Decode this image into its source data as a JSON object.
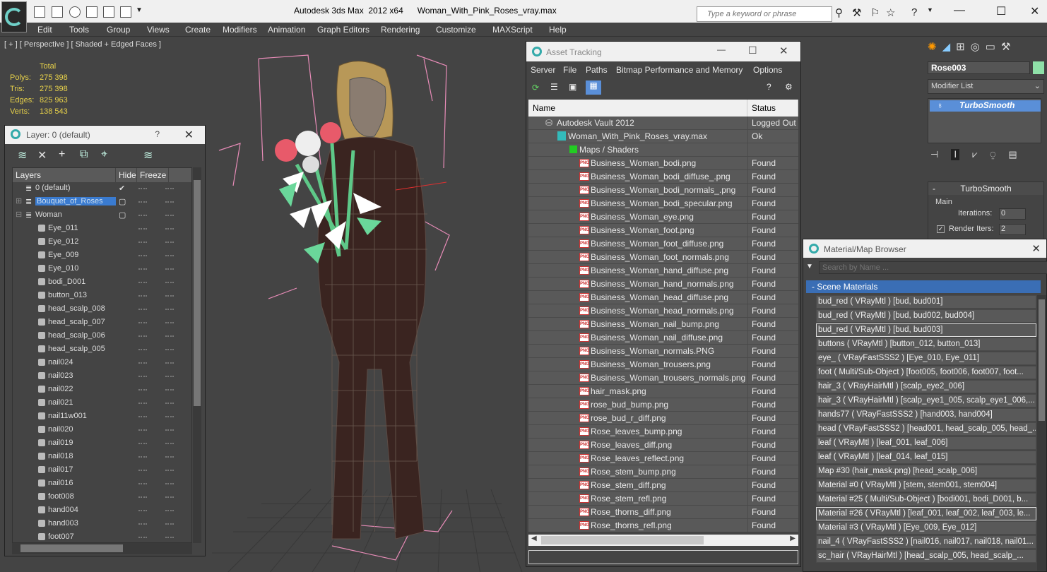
{
  "app": {
    "title": "Autodesk 3ds Max  2012 x64      Woman_With_Pink_Roses_vray.max",
    "search_placeholder": "Type a keyword or phrase"
  },
  "menu": [
    "Edit",
    "Tools",
    "Group",
    "Views",
    "Create",
    "Modifiers",
    "Animation",
    "Graph Editors",
    "Rendering",
    "Customize",
    "MAXScript",
    "Help"
  ],
  "viewport": {
    "label": "[ + ] [ Perspective ] [ Shaded + Edged Faces ]",
    "stats_header": "Total",
    "stats": [
      {
        "key": "Polys:",
        "value": "275 398"
      },
      {
        "key": "Tris:",
        "value": "275 398"
      },
      {
        "key": "Edges:",
        "value": "825 963"
      },
      {
        "key": "Verts:",
        "value": "138 543"
      }
    ]
  },
  "layer_dialog": {
    "title": "Layer: 0 (default)",
    "help": "?",
    "columns": [
      "Layers",
      "Hide",
      "Freeze"
    ],
    "layers": [
      {
        "name": "0 (default)",
        "level": 0,
        "check": "✔",
        "selected": false
      },
      {
        "name": "Bouquet_of_Roses",
        "level": 0,
        "check": "▢",
        "selected": true
      },
      {
        "name": "Woman",
        "level": 0,
        "check": "▢",
        "selected": false
      }
    ],
    "objects": [
      "Eye_011",
      "Eye_012",
      "Eye_009",
      "Eye_010",
      "bodi_D001",
      "button_013",
      "head_scalp_008",
      "head_scalp_007",
      "head_scalp_006",
      "head_scalp_005",
      "nail024",
      "nail023",
      "nail022",
      "nail021",
      "nail11w001",
      "nail020",
      "nail019",
      "nail018",
      "nail017",
      "nail016",
      "foot008",
      "hand004",
      "hand003",
      "foot007"
    ]
  },
  "asset_tracking": {
    "title": "Asset Tracking",
    "menu": [
      "Server",
      "File",
      "Paths",
      "Bitmap Performance and Memory",
      "Options"
    ],
    "columns": [
      "Name",
      "Status"
    ],
    "rows": [
      {
        "name": "Autodesk Vault 2012",
        "status": "Logged Out",
        "icon": "vault",
        "indent": 0
      },
      {
        "name": "Woman_With_Pink_Roses_vray.max",
        "status": "Ok",
        "icon": "max",
        "indent": 1
      },
      {
        "name": "Maps / Shaders",
        "status": "",
        "icon": "maps",
        "indent": 2
      },
      {
        "name": "Business_Woman_bodi.png",
        "status": "Found",
        "icon": "png",
        "indent": 3
      },
      {
        "name": "Business_Woman_bodi_diffuse_.png",
        "status": "Found",
        "icon": "png",
        "indent": 3
      },
      {
        "name": "Business_Woman_bodi_normals_.png",
        "status": "Found",
        "icon": "png",
        "indent": 3
      },
      {
        "name": "Business_Woman_bodi_specular.png",
        "status": "Found",
        "icon": "png",
        "indent": 3
      },
      {
        "name": "Business_Woman_eye.png",
        "status": "Found",
        "icon": "png",
        "indent": 3
      },
      {
        "name": "Business_Woman_foot.png",
        "status": "Found",
        "icon": "png",
        "indent": 3
      },
      {
        "name": "Business_Woman_foot_diffuse.png",
        "status": "Found",
        "icon": "png",
        "indent": 3
      },
      {
        "name": "Business_Woman_foot_normals.png",
        "status": "Found",
        "icon": "png",
        "indent": 3
      },
      {
        "name": "Business_Woman_hand_diffuse.png",
        "status": "Found",
        "icon": "png",
        "indent": 3
      },
      {
        "name": "Business_Woman_hand_normals.png",
        "status": "Found",
        "icon": "png",
        "indent": 3
      },
      {
        "name": "Business_Woman_head_diffuse.png",
        "status": "Found",
        "icon": "png",
        "indent": 3
      },
      {
        "name": "Business_Woman_head_normals.png",
        "status": "Found",
        "icon": "png",
        "indent": 3
      },
      {
        "name": "Business_Woman_nail_bump.png",
        "status": "Found",
        "icon": "png",
        "indent": 3
      },
      {
        "name": "Business_Woman_nail_diffuse.png",
        "status": "Found",
        "icon": "png",
        "indent": 3
      },
      {
        "name": "Business_Woman_normals.PNG",
        "status": "Found",
        "icon": "png",
        "indent": 3
      },
      {
        "name": "Business_Woman_trousers.png",
        "status": "Found",
        "icon": "png",
        "indent": 3
      },
      {
        "name": "Business_Woman_trousers_normals.png",
        "status": "Found",
        "icon": "png",
        "indent": 3
      },
      {
        "name": "hair_mask.png",
        "status": "Found",
        "icon": "png",
        "indent": 3
      },
      {
        "name": "rose_bud_bump.png",
        "status": "Found",
        "icon": "png",
        "indent": 3
      },
      {
        "name": "rose_bud_r_diff.png",
        "status": "Found",
        "icon": "png",
        "indent": 3
      },
      {
        "name": "Rose_leaves_bump.png",
        "status": "Found",
        "icon": "png",
        "indent": 3
      },
      {
        "name": "Rose_leaves_diff.png",
        "status": "Found",
        "icon": "png",
        "indent": 3
      },
      {
        "name": "Rose_leaves_reflect.png",
        "status": "Found",
        "icon": "png",
        "indent": 3
      },
      {
        "name": "Rose_stem_bump.png",
        "status": "Found",
        "icon": "png",
        "indent": 3
      },
      {
        "name": "Rose_stem_diff.png",
        "status": "Found",
        "icon": "png",
        "indent": 3
      },
      {
        "name": "Rose_stem_refl.png",
        "status": "Found",
        "icon": "png",
        "indent": 3
      },
      {
        "name": "Rose_thorns_diff.png",
        "status": "Found",
        "icon": "png",
        "indent": 3
      },
      {
        "name": "Rose_thorns_refl.png",
        "status": "Found",
        "icon": "png",
        "indent": 3
      }
    ]
  },
  "command_panel": {
    "object_name": "Rose003",
    "object_color": "#8fe0a8",
    "modifier_list": "Modifier List",
    "stack_item": "TurboSmooth",
    "rollout_title": "TurboSmooth",
    "main_group": "Main",
    "iterations_label": "Iterations:",
    "iterations_value": "0",
    "render_iters_label": "Render Iters:",
    "render_iters_value": "2"
  },
  "material_browser": {
    "title": "Material/Map Browser",
    "search_placeholder": "Search by Name ...",
    "category": "- Scene Materials",
    "items": [
      {
        "text": "bud_red  ( VRayMtl )  [bud, bud001]",
        "selected": false
      },
      {
        "text": "bud_red  ( VRayMtl )  [bud, bud002, bud004]",
        "selected": false
      },
      {
        "text": "bud_red  ( VRayMtl )  [bud, bud003]",
        "selected": true
      },
      {
        "text": "buttons  ( VRayMtl )  [button_012, button_013]",
        "selected": false
      },
      {
        "text": "eye_  ( VRayFastSSS2 )  [Eye_010, Eye_011]",
        "selected": false
      },
      {
        "text": "foot  ( Multi/Sub-Object )  [foot005, foot006, foot007, foot...",
        "selected": false
      },
      {
        "text": "hair_3  ( VRayHairMtl )  [scalp_eye2_006]",
        "selected": false
      },
      {
        "text": "hair_3  ( VRayHairMtl )  [scalp_eye1_005, scalp_eye1_006,...",
        "selected": false
      },
      {
        "text": "hands77  ( VRayFastSSS2 )  [hand003, hand004]",
        "selected": false
      },
      {
        "text": "head  ( VRayFastSSS2 )  [head001, head_scalp_005, head_...",
        "selected": false
      },
      {
        "text": "leaf  ( VRayMtl )  [leaf_001, leaf_006]",
        "selected": false
      },
      {
        "text": "leaf  ( VRayMtl )  [leaf_014, leaf_015]",
        "selected": false
      },
      {
        "text": "Map #30 (hair_mask.png)  [head_scalp_006]",
        "selected": false
      },
      {
        "text": "Material #0  ( VRayMtl )  [stem, stem001, stem004]",
        "selected": false
      },
      {
        "text": "Material #25  ( Multi/Sub-Object )  [bodi001, bodi_D001, b...",
        "selected": false
      },
      {
        "text": "Material #26  ( VRayMtl )  [leaf_001, leaf_002, leaf_003, le...",
        "selected": true
      },
      {
        "text": "Material #3  ( VRayMtl )  [Eye_009, Eye_012]",
        "selected": false
      },
      {
        "text": "nail_4  ( VRayFastSSS2 )  [nail016, nail017, nail018, nail01...",
        "selected": false
      },
      {
        "text": "sc_hair  ( VRayHairMtl )  [head_scalp_005, head_scalp_...",
        "selected": false
      }
    ]
  }
}
